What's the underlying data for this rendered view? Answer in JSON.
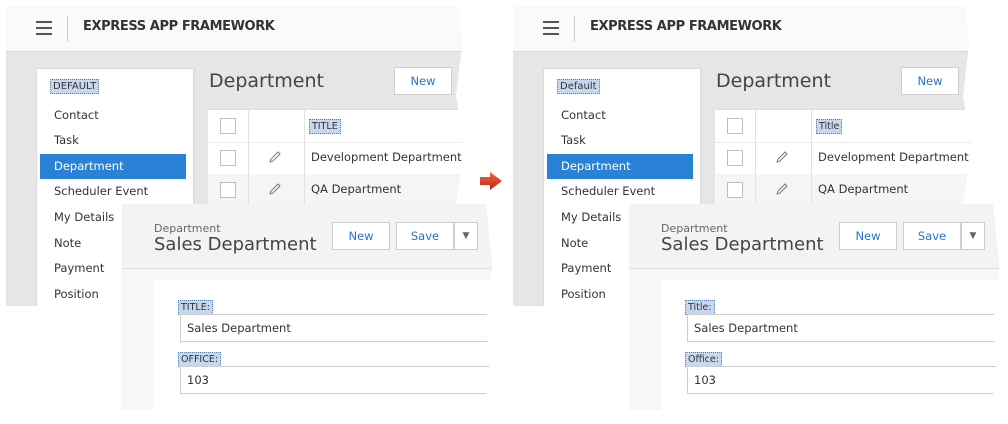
{
  "colors": {
    "accent": "#2a82d6",
    "highlight": "#c7d8ee",
    "arrow": "#d6391f"
  },
  "panels": [
    {
      "app_title": "EXPRESS APP FRAMEWORK",
      "nav_group": "DEFAULT",
      "nav_items": [
        "Contact",
        "Task",
        "Department",
        "Scheduler Event",
        "My Details",
        "Note",
        "Payment",
        "Position"
      ],
      "selected_item": "Department",
      "view_title": "Department",
      "new_label": "New",
      "column_header": "TITLE",
      "rows": [
        "Development Department",
        "QA Department"
      ],
      "detail": {
        "breadcrumb": "Department",
        "object_title": "Sales Department",
        "new_label": "New",
        "save_label": "Save",
        "title_label": "TITLE:",
        "title_value": "Sales Department",
        "office_label": "OFFICE:",
        "office_value": "103"
      }
    },
    {
      "app_title": "EXPRESS APP FRAMEWORK",
      "nav_group": "Default",
      "nav_items": [
        "Contact",
        "Task",
        "Department",
        "Scheduler Event",
        "My Details",
        "Note",
        "Payment",
        "Position"
      ],
      "selected_item": "Department",
      "view_title": "Department",
      "new_label": "New",
      "column_header": "Title",
      "rows": [
        "Development Department",
        "QA Department"
      ],
      "detail": {
        "breadcrumb": "Department",
        "object_title": "Sales Department",
        "new_label": "New",
        "save_label": "Save",
        "title_label": "Title:",
        "title_value": "Sales Department",
        "office_label": "Office:",
        "office_value": "103"
      }
    }
  ]
}
